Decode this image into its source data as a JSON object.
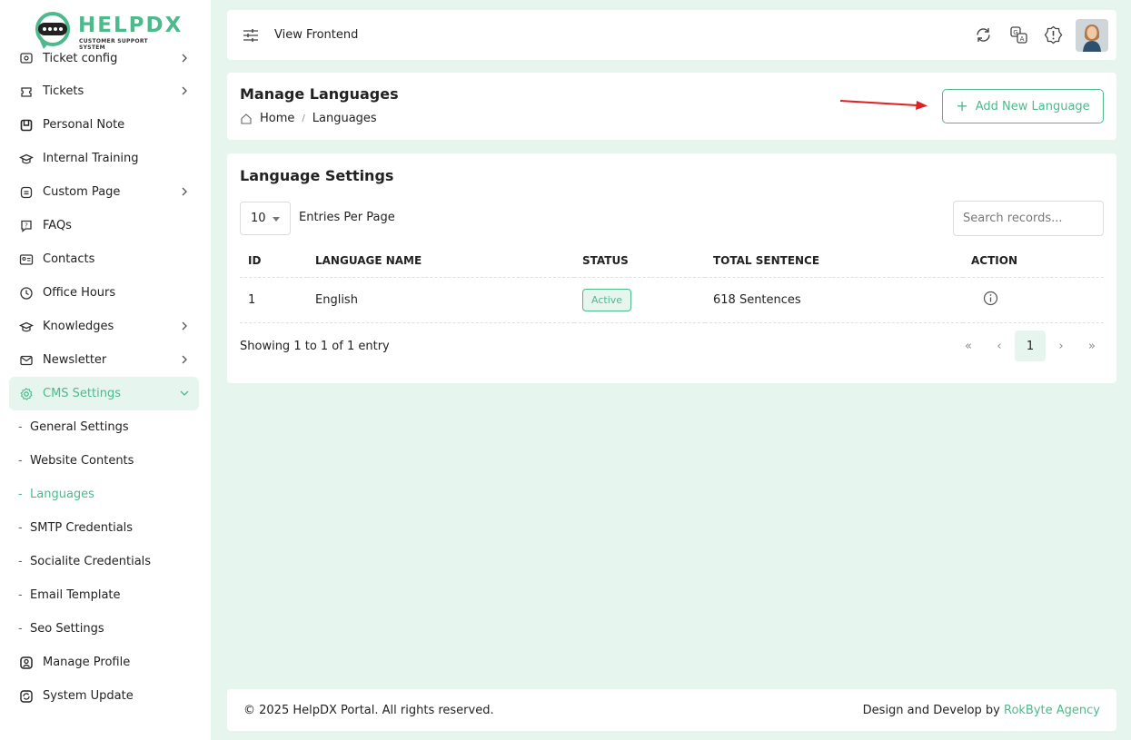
{
  "brand": {
    "name": "HELPDX",
    "tagline": "CUSTOMER SUPPORT SYSTEM"
  },
  "colors": {
    "accent": "#4dba8c",
    "background": "#e6f5ee",
    "arrow": "#e02020"
  },
  "sidebar": {
    "items": [
      {
        "label": "Ticket config",
        "icon": "ticket-config-icon",
        "has_children": true
      },
      {
        "label": "Tickets",
        "icon": "ticket-icon",
        "has_children": true
      },
      {
        "label": "Personal Note",
        "icon": "note-icon",
        "has_children": false
      },
      {
        "label": "Internal Training",
        "icon": "graduation-cap-icon",
        "has_children": false
      },
      {
        "label": "Custom Page",
        "icon": "page-icon",
        "has_children": true
      },
      {
        "label": "FAQs",
        "icon": "question-icon",
        "has_children": false
      },
      {
        "label": "Contacts",
        "icon": "contact-card-icon",
        "has_children": false
      },
      {
        "label": "Office Hours",
        "icon": "clock-icon",
        "has_children": false
      },
      {
        "label": "Knowledges",
        "icon": "knowledge-icon",
        "has_children": true
      },
      {
        "label": "Newsletter",
        "icon": "mail-icon",
        "has_children": true
      },
      {
        "label": "CMS Settings",
        "icon": "gear-icon",
        "has_children": true
      }
    ],
    "cms_sub_items": [
      "General Settings",
      "Website Contents",
      "Languages",
      "SMTP Credentials",
      "Socialite Credentials",
      "Email Template",
      "Seo Settings"
    ],
    "bottom_items": [
      {
        "label": "Manage Profile",
        "icon": "user-icon"
      },
      {
        "label": "System Update",
        "icon": "update-icon"
      }
    ]
  },
  "topbar": {
    "view_frontend": "View Frontend"
  },
  "header": {
    "title": "Manage Languages",
    "breadcrumb": {
      "home": "Home",
      "current": "Languages"
    },
    "add_button": "Add New Language"
  },
  "table_card": {
    "title": "Language Settings",
    "per_page_value": "10",
    "per_page_label": "Entries Per Page",
    "search_placeholder": "Search records...",
    "columns": [
      "ID",
      "LANGUAGE NAME",
      "STATUS",
      "TOTAL SENTENCE",
      "ACTION"
    ],
    "rows": [
      {
        "id": "1",
        "name": "English",
        "status": "Active",
        "total": "618 Sentences"
      }
    ],
    "showing": "Showing 1 to 1 of 1 entry",
    "pagination": {
      "first": "«",
      "prev": "‹",
      "current": "1",
      "next": "›",
      "last": "»"
    }
  },
  "footer": {
    "copyright": "© 2025 HelpDX Portal. All rights reserved.",
    "credit_prefix": "Design and Develop by ",
    "credit_link": "RokByte Agency"
  }
}
